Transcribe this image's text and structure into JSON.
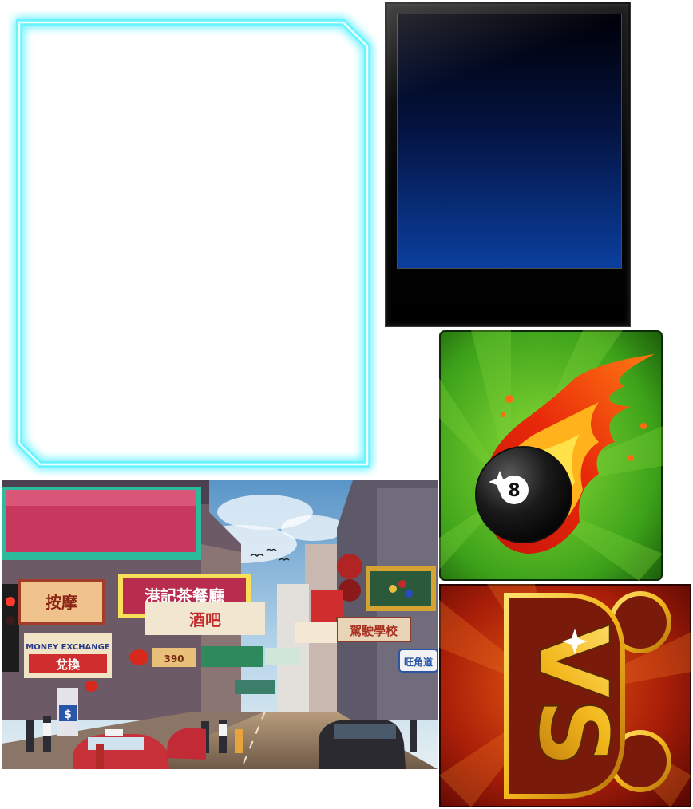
{
  "street_scene": {
    "signs": {
      "tea_house": "港記茶餐廳",
      "bar": "酒吧",
      "massage": "按摩",
      "money_exchange": "MONEY EXCHANGE",
      "exchange_cn": "兌換",
      "driving_school": "駕駛學校",
      "wang_kok_road": "旺角道",
      "currency_symbol": "$",
      "price": "390"
    }
  },
  "fireball": {
    "ball_number": "8"
  },
  "vs_tile": {
    "vs_text": "VS"
  },
  "colors": {
    "neon_cyan": "#4fe9ff",
    "screen_blue": "#0a3f9e",
    "tile_green": "#45b51f",
    "tile_red": "#9a1a07",
    "gold": "#f2b71c"
  }
}
